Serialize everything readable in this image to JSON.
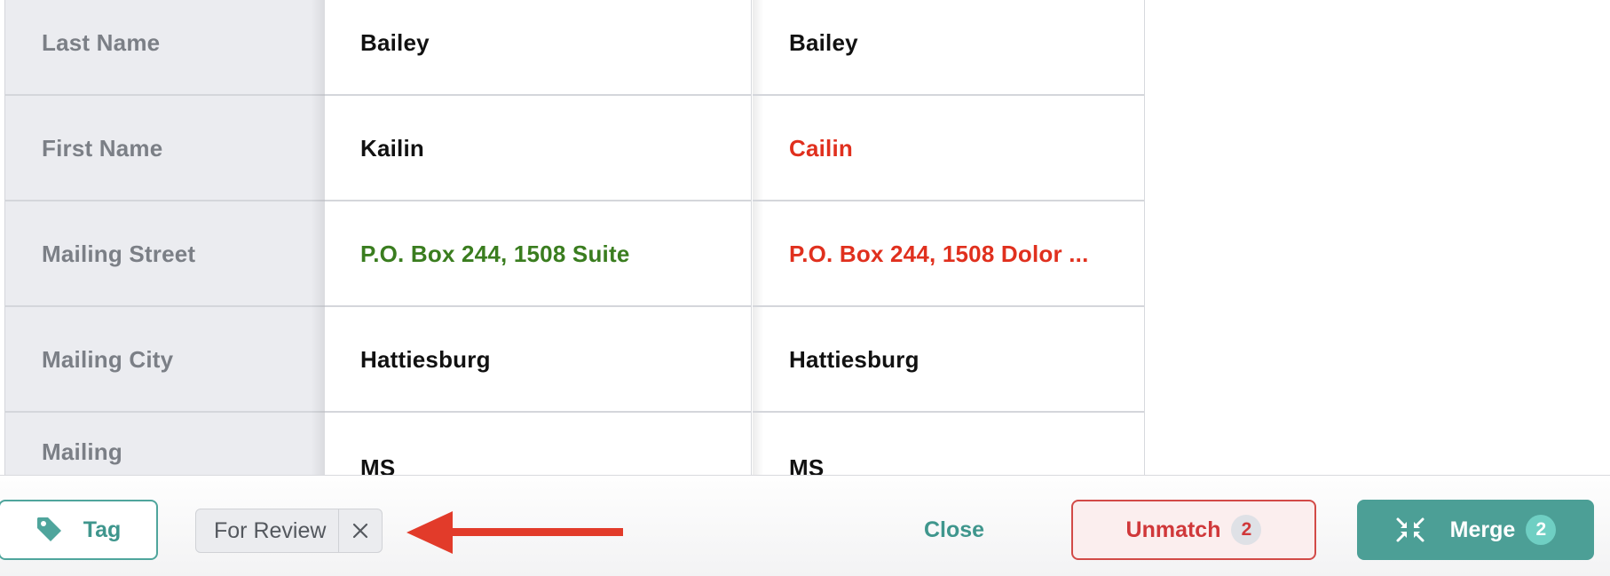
{
  "fields": [
    {
      "label": "Last Name",
      "value_a": "Bailey",
      "value_b": "Bailey",
      "color_a": "",
      "color_b": ""
    },
    {
      "label": "First Name",
      "value_a": "Kailin",
      "value_b": "Cailin",
      "color_a": "",
      "color_b": "red"
    },
    {
      "label": "Mailing Street",
      "value_a": "P.O. Box 244, 1508 Suite",
      "value_b": "P.O. Box 244, 1508 Dolor ...",
      "color_a": "green",
      "color_b": "red"
    },
    {
      "label": "Mailing City",
      "value_a": "Hattiesburg",
      "value_b": "Hattiesburg",
      "color_a": "",
      "color_b": ""
    },
    {
      "label": "Mailing",
      "value_a": "MS",
      "value_b": "MS",
      "color_a": "",
      "color_b": ""
    }
  ],
  "footer": {
    "tag_label": "Tag",
    "tag_chip": "For Review",
    "close_label": "Close",
    "unmatch_label": "Unmatch",
    "unmatch_count": "2",
    "merge_label": "Merge",
    "merge_count": "2"
  },
  "colors": {
    "accent": "#4c9f96",
    "danger": "#d0383a",
    "match_green": "#3a7d1f",
    "diff_red": "#e0301e",
    "arrow_red": "#e23b2a"
  },
  "icons": {
    "tag": "tag-icon",
    "chip_close": "close-icon",
    "merge": "merge-arrows-icon",
    "annotation": "red-arrow-annotation"
  }
}
